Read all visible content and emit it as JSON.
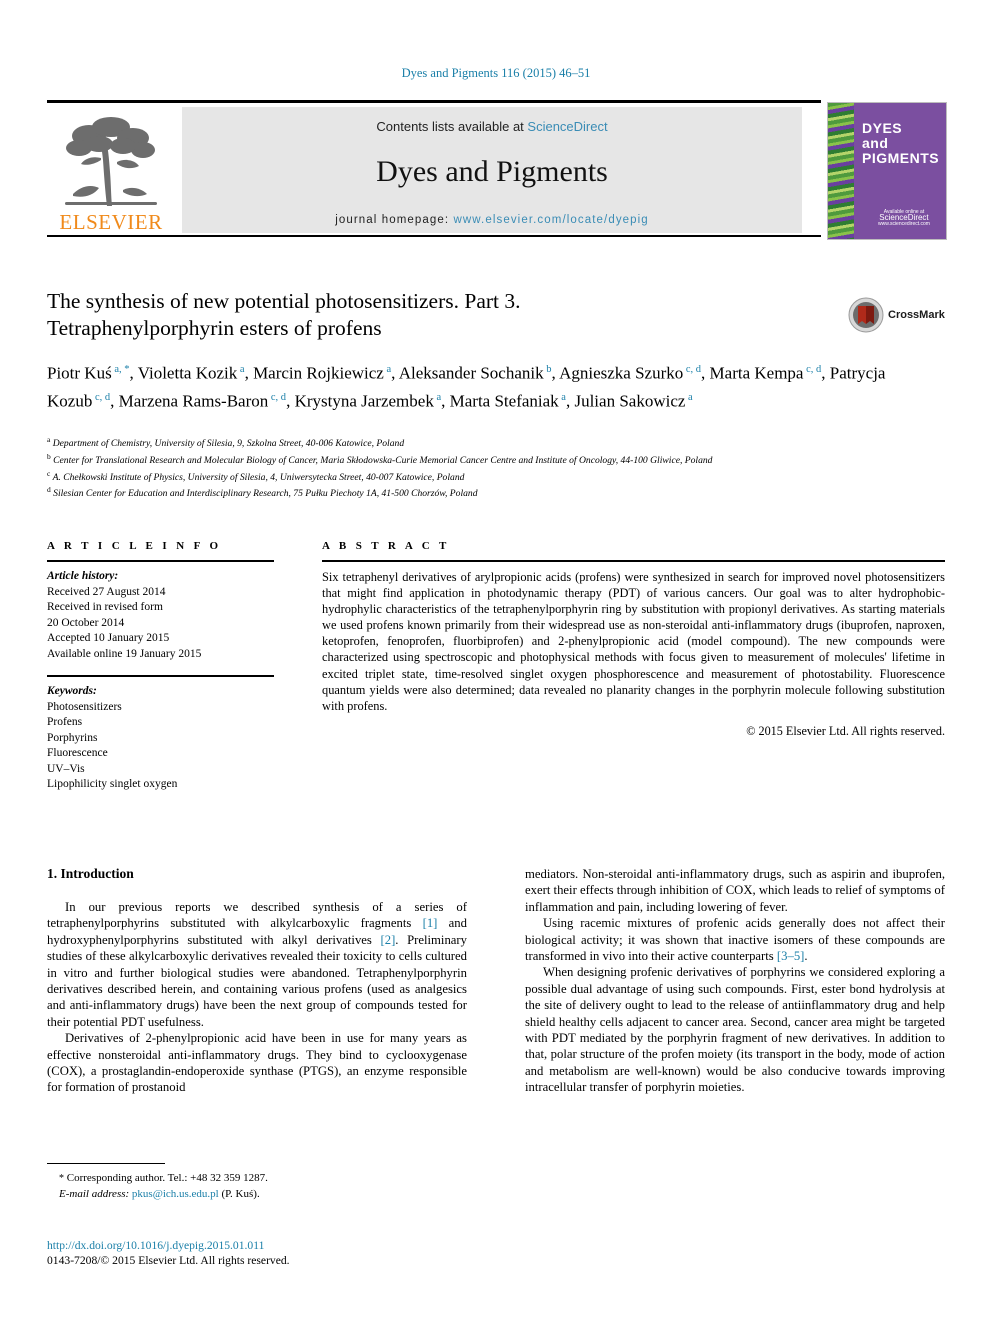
{
  "running_head": "Dyes and Pigments 116 (2015) 46–51",
  "masthead": {
    "contents_prefix": "Contents lists available at ",
    "sciencedirect": "ScienceDirect",
    "journal_name": "Dyes and Pigments",
    "homepage_prefix": "journal homepage: ",
    "homepage_url": "www.elsevier.com/locate/dyepig",
    "publisher_logo_text": "ELSEVIER",
    "cover": {
      "title_line1": "DYES",
      "title_line2": "and",
      "title_line3": "PIGMENTS",
      "footer_small": "Available online at",
      "footer_big": "ScienceDirect",
      "footer_tiny": "www.sciencedirect.com"
    },
    "accent_link_color": "#3a8cb5",
    "elsevier_orange": "#f08a1b",
    "cover_purple": "#7b4fa0"
  },
  "article": {
    "title_line1": "The synthesis of new potential photosensitizers. Part 3.",
    "title_line2": "Tetraphenylporphyrin esters of profens",
    "crossmark_label": "CrossMark",
    "authors": [
      {
        "name": "Piotr Kuś",
        "sup": "a, *"
      },
      {
        "name": "Violetta Kozik",
        "sup": "a"
      },
      {
        "name": "Marcin Rojkiewicz",
        "sup": "a"
      },
      {
        "name": "Aleksander Sochanik",
        "sup": "b"
      },
      {
        "name": "Agnieszka Szurko",
        "sup": "c, d"
      },
      {
        "name": "Marta Kempa",
        "sup": "c, d"
      },
      {
        "name": "Patrycja Kozub",
        "sup": "c, d"
      },
      {
        "name": "Marzena Rams-Baron",
        "sup": "c, d"
      },
      {
        "name": "Krystyna Jarzembek",
        "sup": "a"
      },
      {
        "name": "Marta Stefaniak",
        "sup": "a"
      },
      {
        "name": "Julian Sakowicz",
        "sup": "a"
      }
    ],
    "affiliations": [
      {
        "marker": "a",
        "text": "Department of Chemistry, University of Silesia, 9, Szkolna Street, 40-006 Katowice, Poland"
      },
      {
        "marker": "b",
        "text": "Center for Translational Research and Molecular Biology of Cancer, Maria Skłodowska-Curie Memorial Cancer Centre and Institute of Oncology, 44-100 Gliwice, Poland"
      },
      {
        "marker": "c",
        "text": "A. Chełkowski Institute of Physics, University of Silesia, 4, Uniwersytecka Street, 40-007 Katowice, Poland"
      },
      {
        "marker": "d",
        "text": "Silesian Center for Education and Interdisciplinary Research, 75 Pułku Piechoty 1A, 41-500 Chorzów, Poland"
      }
    ]
  },
  "article_info": {
    "heading": "A R T I C L E   I N F O",
    "history_heading": "Article history:",
    "history": [
      "Received 27 August 2014",
      "Received in revised form",
      "20 October 2014",
      "Accepted 10 January 2015",
      "Available online 19 January 2015"
    ],
    "keywords_heading": "Keywords:",
    "keywords": [
      "Photosensitizers",
      "Profens",
      "Porphyrins",
      "Fluorescence",
      "UV–Vis",
      "Lipophilicity singlet oxygen"
    ]
  },
  "abstract": {
    "heading": "A B S T R A C T",
    "text": "Six tetraphenyl derivatives of arylpropionic acids (profens) were synthesized in search for improved novel photosensitizers that might find application in photodynamic therapy (PDT) of various cancers. Our goal was to alter hydrophobic-hydrophylic characteristics of the tetraphenylporphyrin ring by substitution with propionyl derivatives. As starting materials we used profens known primarily from their widespread use as non-steroidal anti-inflammatory drugs (ibuprofen, naproxen, ketoprofen, fenoprofen, fluorbiprofen) and 2-phenylpropionic acid (model compound). The new compounds were characterized using spectroscopic and photophysical methods with focus given to measurement of molecules' lifetime in excited triplet state, time-resolved singlet oxygen phosphorescence and measurement of photostability. Fluorescence quantum yields were also determined; data revealed no planarity changes in the porphyrin molecule following substitution with profens.",
    "copyright": "© 2015 Elsevier Ltd. All rights reserved."
  },
  "body": {
    "section_heading": "1. Introduction",
    "left_paragraphs": [
      {
        "parts": [
          {
            "t": "In our previous reports we described synthesis of a series of tetraphenylporphyrins substituted with alkylcarboxylic fragments "
          },
          {
            "t": "[1]",
            "ref": true
          },
          {
            "t": " and hydroxyphenylporphyrins substituted with alkyl derivatives "
          },
          {
            "t": "[2]",
            "ref": true
          },
          {
            "t": ". Preliminary studies of these alkylcarboxylic derivatives revealed their toxicity to cells cultured in vitro and further biological studies were abandoned. Tetraphenylporphyrin derivatives described herein, and containing various profens (used as analgesics and anti-inflammatory drugs) have been the next group of compounds tested for their potential PDT usefulness."
          }
        ]
      },
      {
        "parts": [
          {
            "t": "Derivatives of 2-phenylpropionic acid have been in use for many years as effective nonsteroidal anti-inflammatory drugs. They bind to cyclooxygenase (COX), a prostaglandin-endoperoxide synthase (PTGS), an enzyme responsible for formation of prostanoid"
          }
        ]
      }
    ],
    "right_paragraphs": [
      {
        "continuation": true,
        "parts": [
          {
            "t": "mediators. Non-steroidal anti-inflammatory drugs, such as aspirin and ibuprofen, exert their effects through inhibition of COX, which leads to relief of symptoms of inflammation and pain, including lowering of fever."
          }
        ]
      },
      {
        "parts": [
          {
            "t": "Using racemic mixtures of profenic acids generally does not affect their biological activity; it was shown that inactive isomers of these compounds are transformed in vivo into their active counterparts "
          },
          {
            "t": "[3–5]",
            "ref": true
          },
          {
            "t": "."
          }
        ]
      },
      {
        "parts": [
          {
            "t": "When designing profenic derivatives of porphyrins we considered exploring a possible dual advantage of using such compounds. First, ester bond hydrolysis at the site of delivery ought to lead to the release of antiinflammatory drug and help shield healthy cells adjacent to cancer area. Second, cancer area might be targeted with PDT mediated by the porphyrin fragment of new derivatives. In addition to that, polar structure of the profen moiety (its transport in the body, mode of action and metabolism are well-known) would be also conducive towards improving intracellular transfer of porphyrin moieties."
          }
        ]
      }
    ]
  },
  "footnotes": {
    "corresponding": "Corresponding author. Tel.: +48 32 359 1287.",
    "email_label": "E-mail address:",
    "email": "pkus@ich.us.edu.pl",
    "email_suffix": "(P. Kuś).",
    "doi_url": "http://dx.doi.org/10.1016/j.dyepig.2015.01.011",
    "issn_line": "0143-7208/© 2015 Elsevier Ltd. All rights reserved."
  }
}
